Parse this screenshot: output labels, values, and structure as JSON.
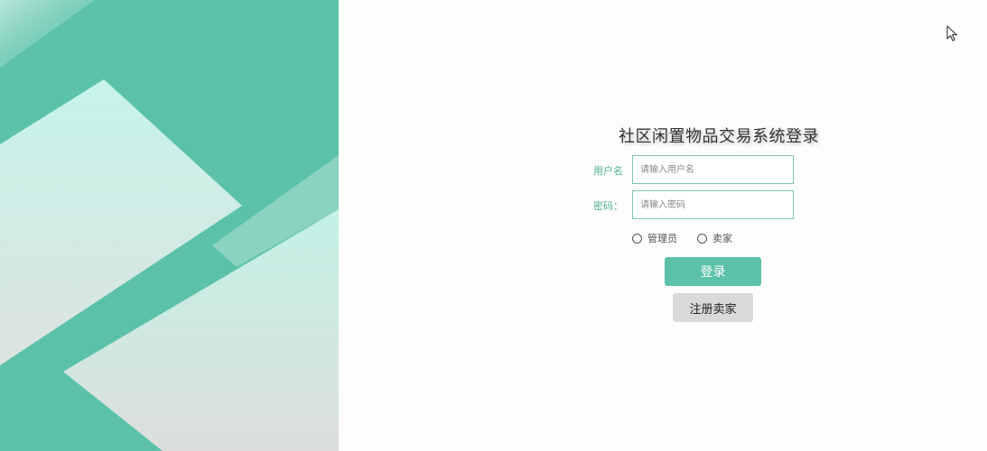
{
  "page": {
    "title": "社区闲置物品交易系统登录"
  },
  "form": {
    "username_label": "用户名",
    "username_placeholder": "请输入用户名",
    "username_value": "",
    "password_label": "密码：",
    "password_placeholder": "请输入密码",
    "password_value": "",
    "roles": [
      {
        "label": "管理员",
        "selected": false
      },
      {
        "label": "卖家",
        "selected": false
      }
    ],
    "login_label": "登录",
    "register_label": "注册卖家"
  },
  "colors": {
    "accent": "#5bc2a9",
    "panel_bg": "#5bc2a9",
    "label_text": "#4fae95",
    "secondary_button": "#d9d9d9"
  },
  "icons": {
    "cursor": "mouse-pointer-icon",
    "radio": "radio-unchecked-icon"
  }
}
